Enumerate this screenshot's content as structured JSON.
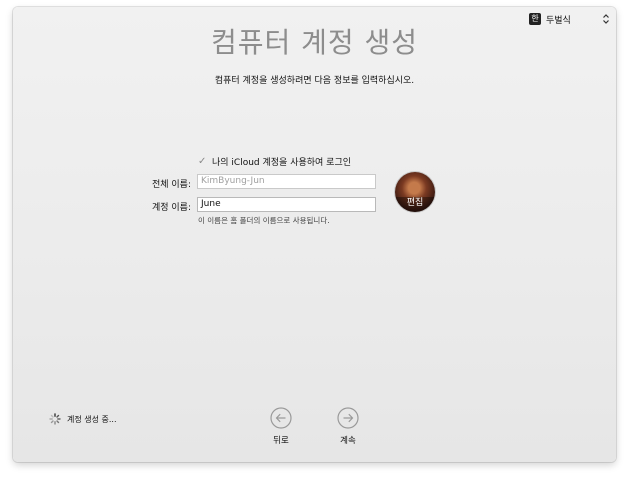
{
  "input_menu": {
    "icon_glyph": "한",
    "label": "두벌식",
    "icon_name": "input-source-icon",
    "arrows_icon": "chevron-updown-icon"
  },
  "page": {
    "title": "컴퓨터 계정 생성",
    "subtitle": "컴퓨터 계정을 생성하려면 다음 정보를 입력하십시오."
  },
  "form": {
    "icloud_checkbox": {
      "checked": true,
      "label": "나의 iCloud 계정을 사용하여 로그인"
    },
    "full_name": {
      "label": "전체 이름:",
      "value": "KimByung-Jun"
    },
    "account_name": {
      "label": "계정 이름:",
      "value": "June",
      "helper": "이 이름은 홈 폴더의 이름으로 사용됩니다."
    },
    "avatar": {
      "edit_label": "편집"
    }
  },
  "status": {
    "progress_text": "계정 생성 중..."
  },
  "navigation": {
    "back_label": "뒤로",
    "continue_label": "계속"
  },
  "colors": {
    "title_gray": "#8d8d8d",
    "window_bg": "#ececec",
    "nav_circle": "#9a9a9a"
  }
}
